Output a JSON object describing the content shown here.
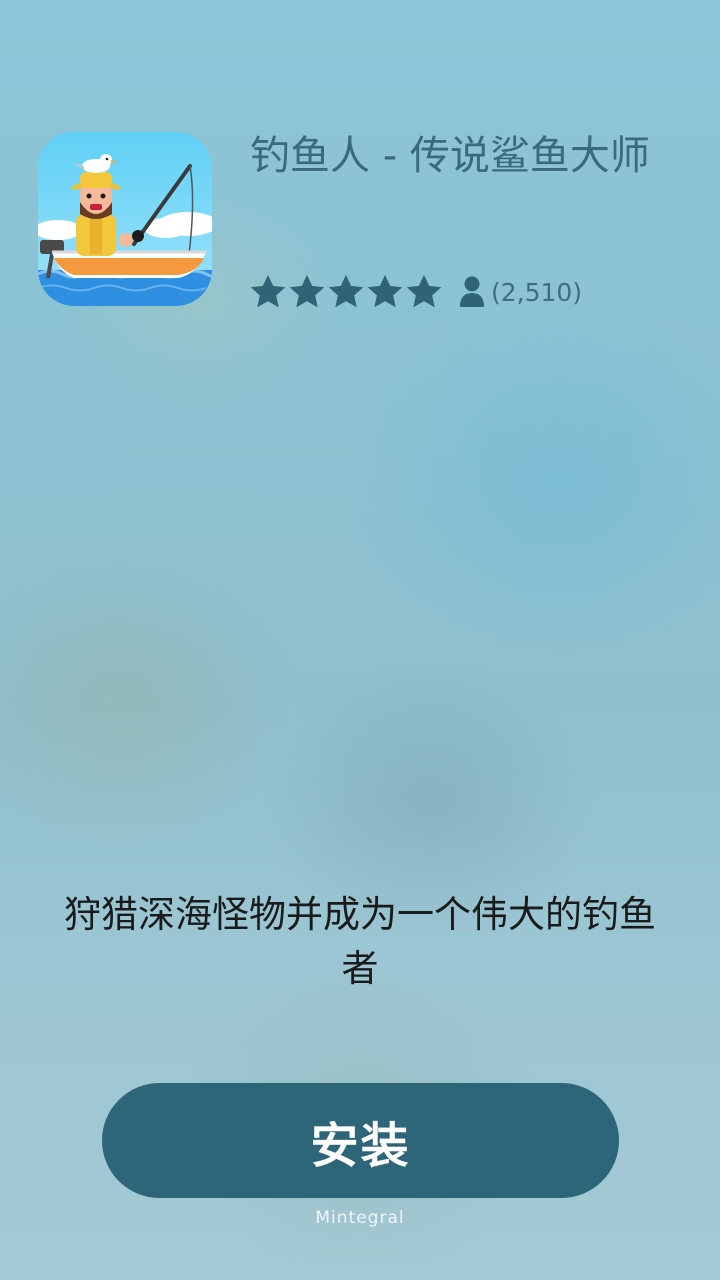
{
  "app": {
    "title": "钓鱼人 - 传说鲨鱼大师",
    "icon": "fisherman-game-icon",
    "rating": {
      "stars": 5,
      "max": 5,
      "review_count": "(2,510)"
    }
  },
  "tagline": "狩猎深海怪物并成为一个伟大的钓鱼者",
  "install_button": {
    "label": "安装"
  },
  "brand": {
    "name": "Mintegral"
  },
  "colors": {
    "accent": "#2e6679",
    "title": "#3b6a7c",
    "star": "#2f6476"
  }
}
